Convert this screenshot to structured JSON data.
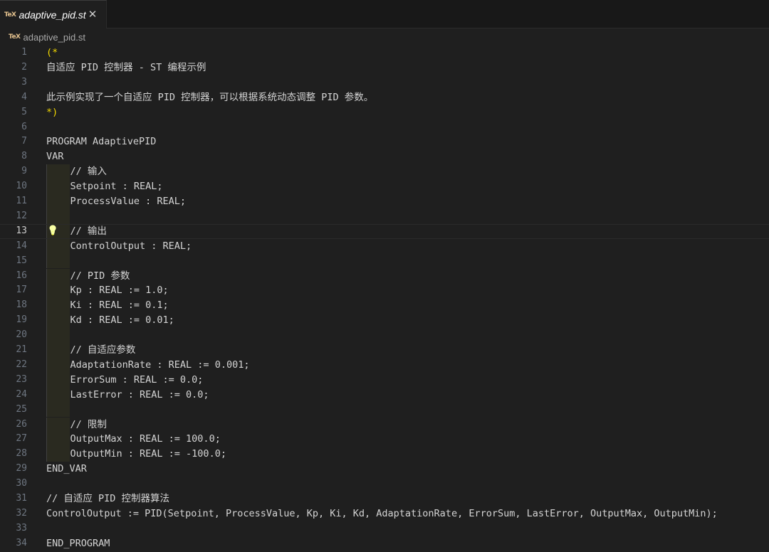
{
  "tab": {
    "icon": "TeX",
    "label": "adaptive_pid.st",
    "close_glyph": "✕"
  },
  "breadcrumb": {
    "icon": "TeX",
    "label": "adaptive_pid.st"
  },
  "editor": {
    "current_line": 13,
    "lines": [
      {
        "n": "1",
        "text": "(*",
        "indent": 0
      },
      {
        "n": "2",
        "text": "自适应 PID 控制器 - ST 编程示例",
        "indent": 0
      },
      {
        "n": "3",
        "text": "",
        "indent": 0
      },
      {
        "n": "4",
        "text": "此示例实现了一个自适应 PID 控制器，可以根据系统动态调整 PID 参数。",
        "indent": 0
      },
      {
        "n": "5",
        "text": "*)",
        "indent": 0
      },
      {
        "n": "6",
        "text": "",
        "indent": 0
      },
      {
        "n": "7",
        "text": "PROGRAM AdaptivePID",
        "indent": 0
      },
      {
        "n": "8",
        "text": "VAR",
        "indent": 0
      },
      {
        "n": "9",
        "text": "// 输入",
        "indent": 1
      },
      {
        "n": "10",
        "text": "Setpoint : REAL;",
        "indent": 1
      },
      {
        "n": "11",
        "text": "ProcessValue : REAL;",
        "indent": 1
      },
      {
        "n": "12",
        "text": "",
        "indent": 1
      },
      {
        "n": "13",
        "text": "// 输出",
        "indent": 1
      },
      {
        "n": "14",
        "text": "ControlOutput : REAL;",
        "indent": 1
      },
      {
        "n": "15",
        "text": "",
        "indent": 1
      },
      {
        "n": "16",
        "text": "// PID 参数",
        "indent": 1
      },
      {
        "n": "17",
        "text": "Kp : REAL := 1.0;",
        "indent": 1
      },
      {
        "n": "18",
        "text": "Ki : REAL := 0.1;",
        "indent": 1
      },
      {
        "n": "19",
        "text": "Kd : REAL := 0.01;",
        "indent": 1
      },
      {
        "n": "20",
        "text": "",
        "indent": 1
      },
      {
        "n": "21",
        "text": "// 自适应参数",
        "indent": 1
      },
      {
        "n": "22",
        "text": "AdaptationRate : REAL := 0.001;",
        "indent": 1
      },
      {
        "n": "23",
        "text": "ErrorSum : REAL := 0.0;",
        "indent": 1
      },
      {
        "n": "24",
        "text": "LastError : REAL := 0.0;",
        "indent": 1
      },
      {
        "n": "25",
        "text": "",
        "indent": 1
      },
      {
        "n": "26",
        "text": "// 限制",
        "indent": 1
      },
      {
        "n": "27",
        "text": "OutputMax : REAL := 100.0;",
        "indent": 1
      },
      {
        "n": "28",
        "text": "OutputMin : REAL := -100.0;",
        "indent": 1
      },
      {
        "n": "29",
        "text": "END_VAR",
        "indent": 0
      },
      {
        "n": "30",
        "text": "",
        "indent": 0
      },
      {
        "n": "31",
        "text": "// 自适应 PID 控制器算法",
        "indent": 0
      },
      {
        "n": "32",
        "text": "ControlOutput := PID(Setpoint, ProcessValue, Kp, Ki, Kd, AdaptationRate, ErrorSum, LastError, OutputMax, OutputMin);",
        "indent": 0
      },
      {
        "n": "33",
        "text": "",
        "indent": 0
      },
      {
        "n": "34",
        "text": "END_PROGRAM",
        "indent": 0
      }
    ]
  },
  "colors": {
    "background": "#1f1f1f",
    "text": "#d4d4d4",
    "line_number": "#6e7681",
    "bracket": "#f1d700",
    "lightbulb": "#f0c419"
  },
  "icons": {
    "file_icon": "tex-file-icon",
    "close": "close-icon",
    "hint": "lightbulb-icon"
  }
}
